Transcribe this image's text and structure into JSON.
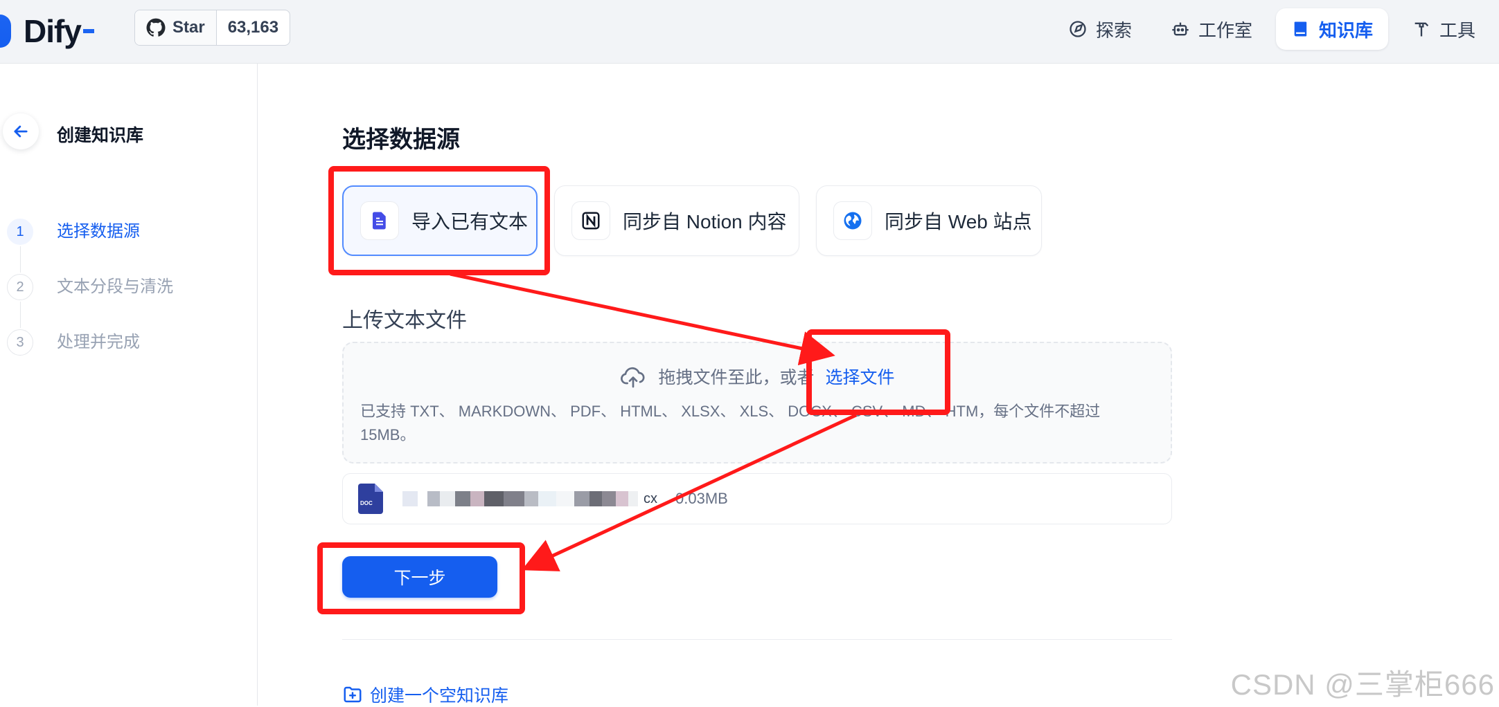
{
  "header": {
    "brand": "Dify",
    "github": {
      "star_label": "Star",
      "count": "63,163"
    },
    "nav": [
      {
        "label": "探索",
        "icon": "compass-icon"
      },
      {
        "label": "工作室",
        "icon": "robot-icon"
      },
      {
        "label": "知识库",
        "icon": "book-icon",
        "active": true
      },
      {
        "label": "工具",
        "icon": "hammer-icon"
      }
    ]
  },
  "sidebar": {
    "title": "创建知识库",
    "steps": [
      {
        "num": "1",
        "label": "选择数据源",
        "active": true
      },
      {
        "num": "2",
        "label": "文本分段与清洗"
      },
      {
        "num": "3",
        "label": "处理并完成"
      }
    ]
  },
  "main": {
    "title": "选择数据源",
    "sources": [
      {
        "label": "导入已有文本",
        "icon": "file-text-icon",
        "selected": true
      },
      {
        "label": "同步自 Notion 内容",
        "icon": "notion-icon"
      },
      {
        "label": "同步自 Web 站点",
        "icon": "globe-icon"
      }
    ],
    "upload": {
      "title": "上传文本文件",
      "drop_text": "拖拽文件至此，或者",
      "select_link": "选择文件",
      "tip": "已支持 TXT、 MARKDOWN、 PDF、 HTML、 XLSX、 XLS、 DOCX、 CSV、 MD、 HTM，每个文件不超过 15MB。"
    },
    "file": {
      "ext": "cx",
      "size": "0.03MB",
      "icon": "doc-file-icon"
    },
    "next_label": "下一步",
    "empty_link": "创建一个空知识库"
  },
  "watermark": "CSDN @三掌柜666",
  "colors": {
    "accent": "#155eef",
    "annotation": "#ff1a1a"
  }
}
